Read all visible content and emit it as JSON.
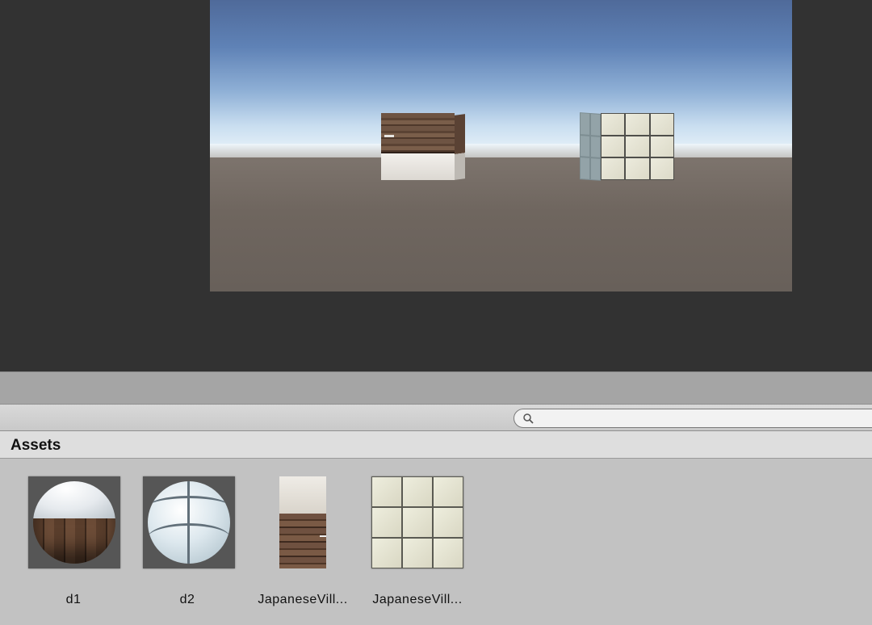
{
  "search": {
    "placeholder": "",
    "value": ""
  },
  "panel": {
    "title": "Assets"
  },
  "assets": [
    {
      "label": "d1",
      "icon": "material-sphere-wood-plaster-icon"
    },
    {
      "label": "d2",
      "icon": "material-sphere-tile-icon"
    },
    {
      "label": "JapaneseVill...",
      "icon": "texture-wood-plaster-icon"
    },
    {
      "label": "JapaneseVill...",
      "icon": "texture-tile-icon"
    }
  ],
  "colors": {
    "editor_bg": "#323232",
    "panel_bg": "#c2c2c2",
    "header_bg": "#dedede",
    "splitter": "#a5a5a5"
  }
}
